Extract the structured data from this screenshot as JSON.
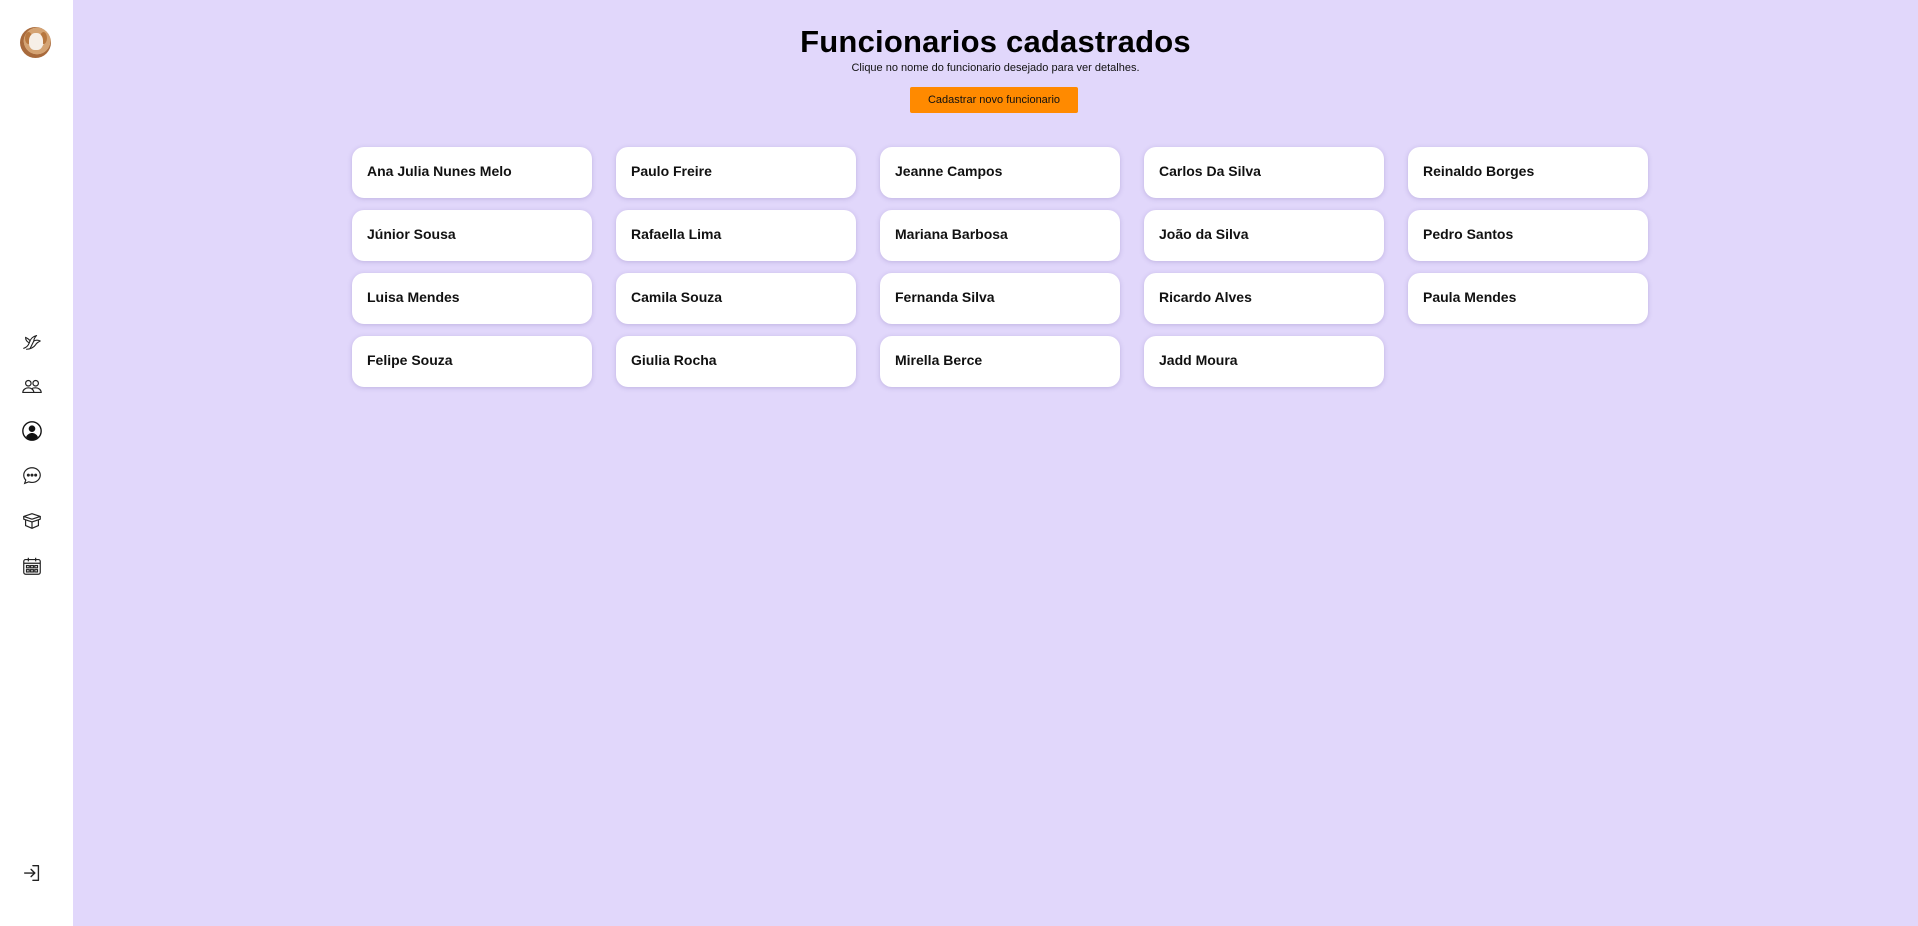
{
  "sidebar": {
    "avatar": "user-avatar",
    "items": [
      {
        "icon": "dove-icon"
      },
      {
        "icon": "team-icon"
      },
      {
        "icon": "user-circle-icon"
      },
      {
        "icon": "chat-icon"
      },
      {
        "icon": "box-icon"
      },
      {
        "icon": "calendar-icon"
      }
    ],
    "logout_icon": "logout-icon"
  },
  "header": {
    "title": "Funcionarios cadastrados",
    "subtitle": "Clique no nome do funcionario desejado para ver detalhes.",
    "add_button_label": "Cadastrar novo funcionario"
  },
  "employees": [
    "Ana Julia Nunes Melo",
    "Paulo Freire",
    "Jeanne Campos",
    "Carlos Da Silva",
    "Reinaldo Borges",
    "Júnior Sousa",
    "Rafaella Lima",
    "Mariana Barbosa",
    "João da Silva",
    "Pedro Santos",
    "Luisa Mendes",
    "Camila Souza",
    "Fernanda Silva",
    "Ricardo Alves",
    "Paula Mendes",
    "Felipe Souza",
    "Giulia Rocha",
    "Mirella Berce",
    "Jadd Moura"
  ],
  "colors": {
    "background": "#e1d7fb",
    "sidebar": "#ffffff",
    "accent": "#ff8a00",
    "card": "#ffffff"
  }
}
